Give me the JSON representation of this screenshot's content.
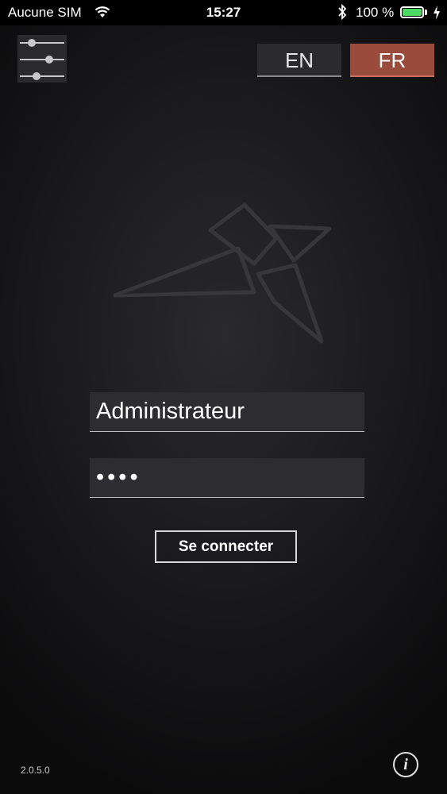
{
  "status_bar": {
    "carrier": "Aucune SIM",
    "time": "15:27",
    "battery_percent": "100 %",
    "battery_level": 1.0,
    "battery_color": "#4cd964",
    "icons": [
      "wifi-icon",
      "bluetooth-icon",
      "battery-icon",
      "charging-icon"
    ]
  },
  "toolbar": {
    "settings_icon": "sliders-icon",
    "languages": [
      {
        "label": "EN",
        "selected": false
      },
      {
        "label": "FR",
        "selected": true
      }
    ],
    "selected_color": "#9b4b3b"
  },
  "login": {
    "username_value": "Administrateur",
    "password_value": "••••",
    "submit_label": "Se connecter"
  },
  "footer": {
    "version": "2.0.5.0",
    "info_icon": "info-icon",
    "info_glyph": "i"
  }
}
